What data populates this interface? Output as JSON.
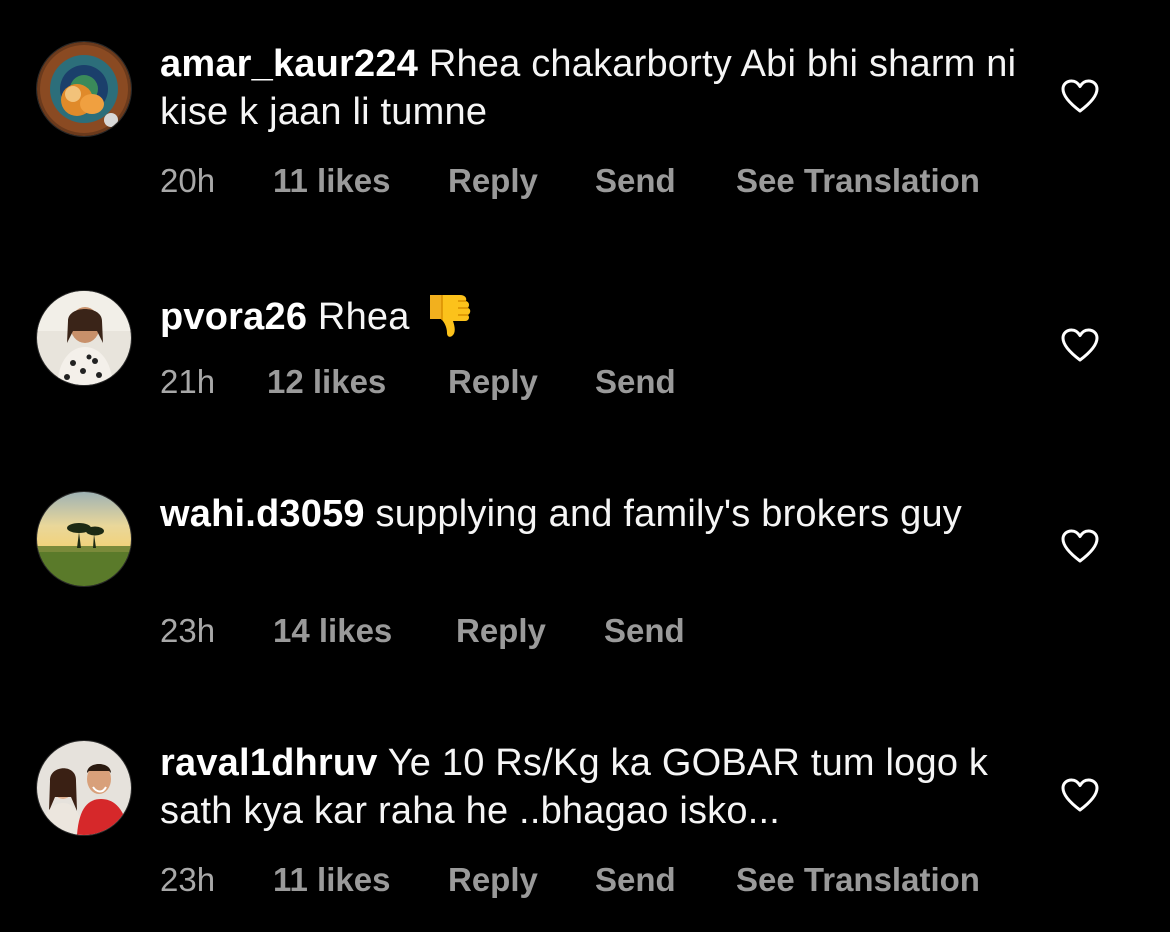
{
  "colors": {
    "background": "#000000",
    "text": "#ffffff",
    "meta_text": "#a8a8a8",
    "heart_outline": "#ffffff"
  },
  "comments": [
    {
      "username": "amar_kaur224",
      "text": "Rhea chakarborty Abi bhi sharm ni kise k jaan li tumne",
      "time": "20h",
      "likes": "11 likes",
      "reply": "Reply",
      "send": "Send",
      "translation": "See Translation",
      "avatar_icon": "peacock-feather-avatar",
      "like_icon": "heart-outline-icon"
    },
    {
      "username": "pvora26",
      "text": "Rhea",
      "emoji": "thumbs-down",
      "time": "21h",
      "likes": "12 likes",
      "reply": "Reply",
      "send": "Send",
      "avatar_icon": "woman-portrait-avatar",
      "like_icon": "heart-outline-icon"
    },
    {
      "username": "wahi.d3059",
      "text": "supplying and family's brokers guy",
      "time": "23h",
      "likes": "14 likes",
      "reply": "Reply",
      "send": "Send",
      "avatar_icon": "savanna-tree-avatar",
      "like_icon": "heart-outline-icon"
    },
    {
      "username": "raval1dhruv",
      "text": "Ye 10 Rs/Kg ka GOBAR tum logo k sath kya kar raha he ..bhagao isko...",
      "time": "23h",
      "likes": "11 likes",
      "reply": "Reply",
      "send": "Send",
      "translation": "See Translation",
      "avatar_icon": "couple-photo-avatar",
      "like_icon": "heart-outline-icon"
    }
  ]
}
